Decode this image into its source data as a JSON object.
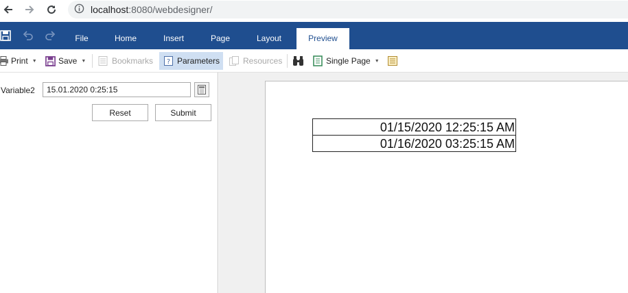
{
  "browser": {
    "url_host": "localhost",
    "url_rest": ":8080/webdesigner/",
    "back_icon": "arrow-left-icon",
    "forward_icon": "arrow-right-icon",
    "reload_icon": "reload-icon",
    "info_icon": "info-icon"
  },
  "ribbon": {
    "tabs": [
      {
        "label": "File"
      },
      {
        "label": "Home"
      },
      {
        "label": "Insert"
      },
      {
        "label": "Page"
      },
      {
        "label": "Layout"
      },
      {
        "label": "Preview"
      }
    ],
    "active_tab": "Preview",
    "background_color": "#1f4e8f"
  },
  "toolbar": {
    "print_label": "Print",
    "save_label": "Save",
    "bookmarks_label": "Bookmarks",
    "parameters_label": "Parameters",
    "resources_label": "Resources",
    "view_mode_label": "Single Page"
  },
  "params": {
    "label": "Variable2",
    "value": "15.01.2020 0:25:15",
    "reset_label": "Reset",
    "submit_label": "Submit"
  },
  "report": {
    "rows": [
      "01/15/2020 12:25:15 AM",
      "01/16/2020 03:25:15 AM"
    ]
  }
}
